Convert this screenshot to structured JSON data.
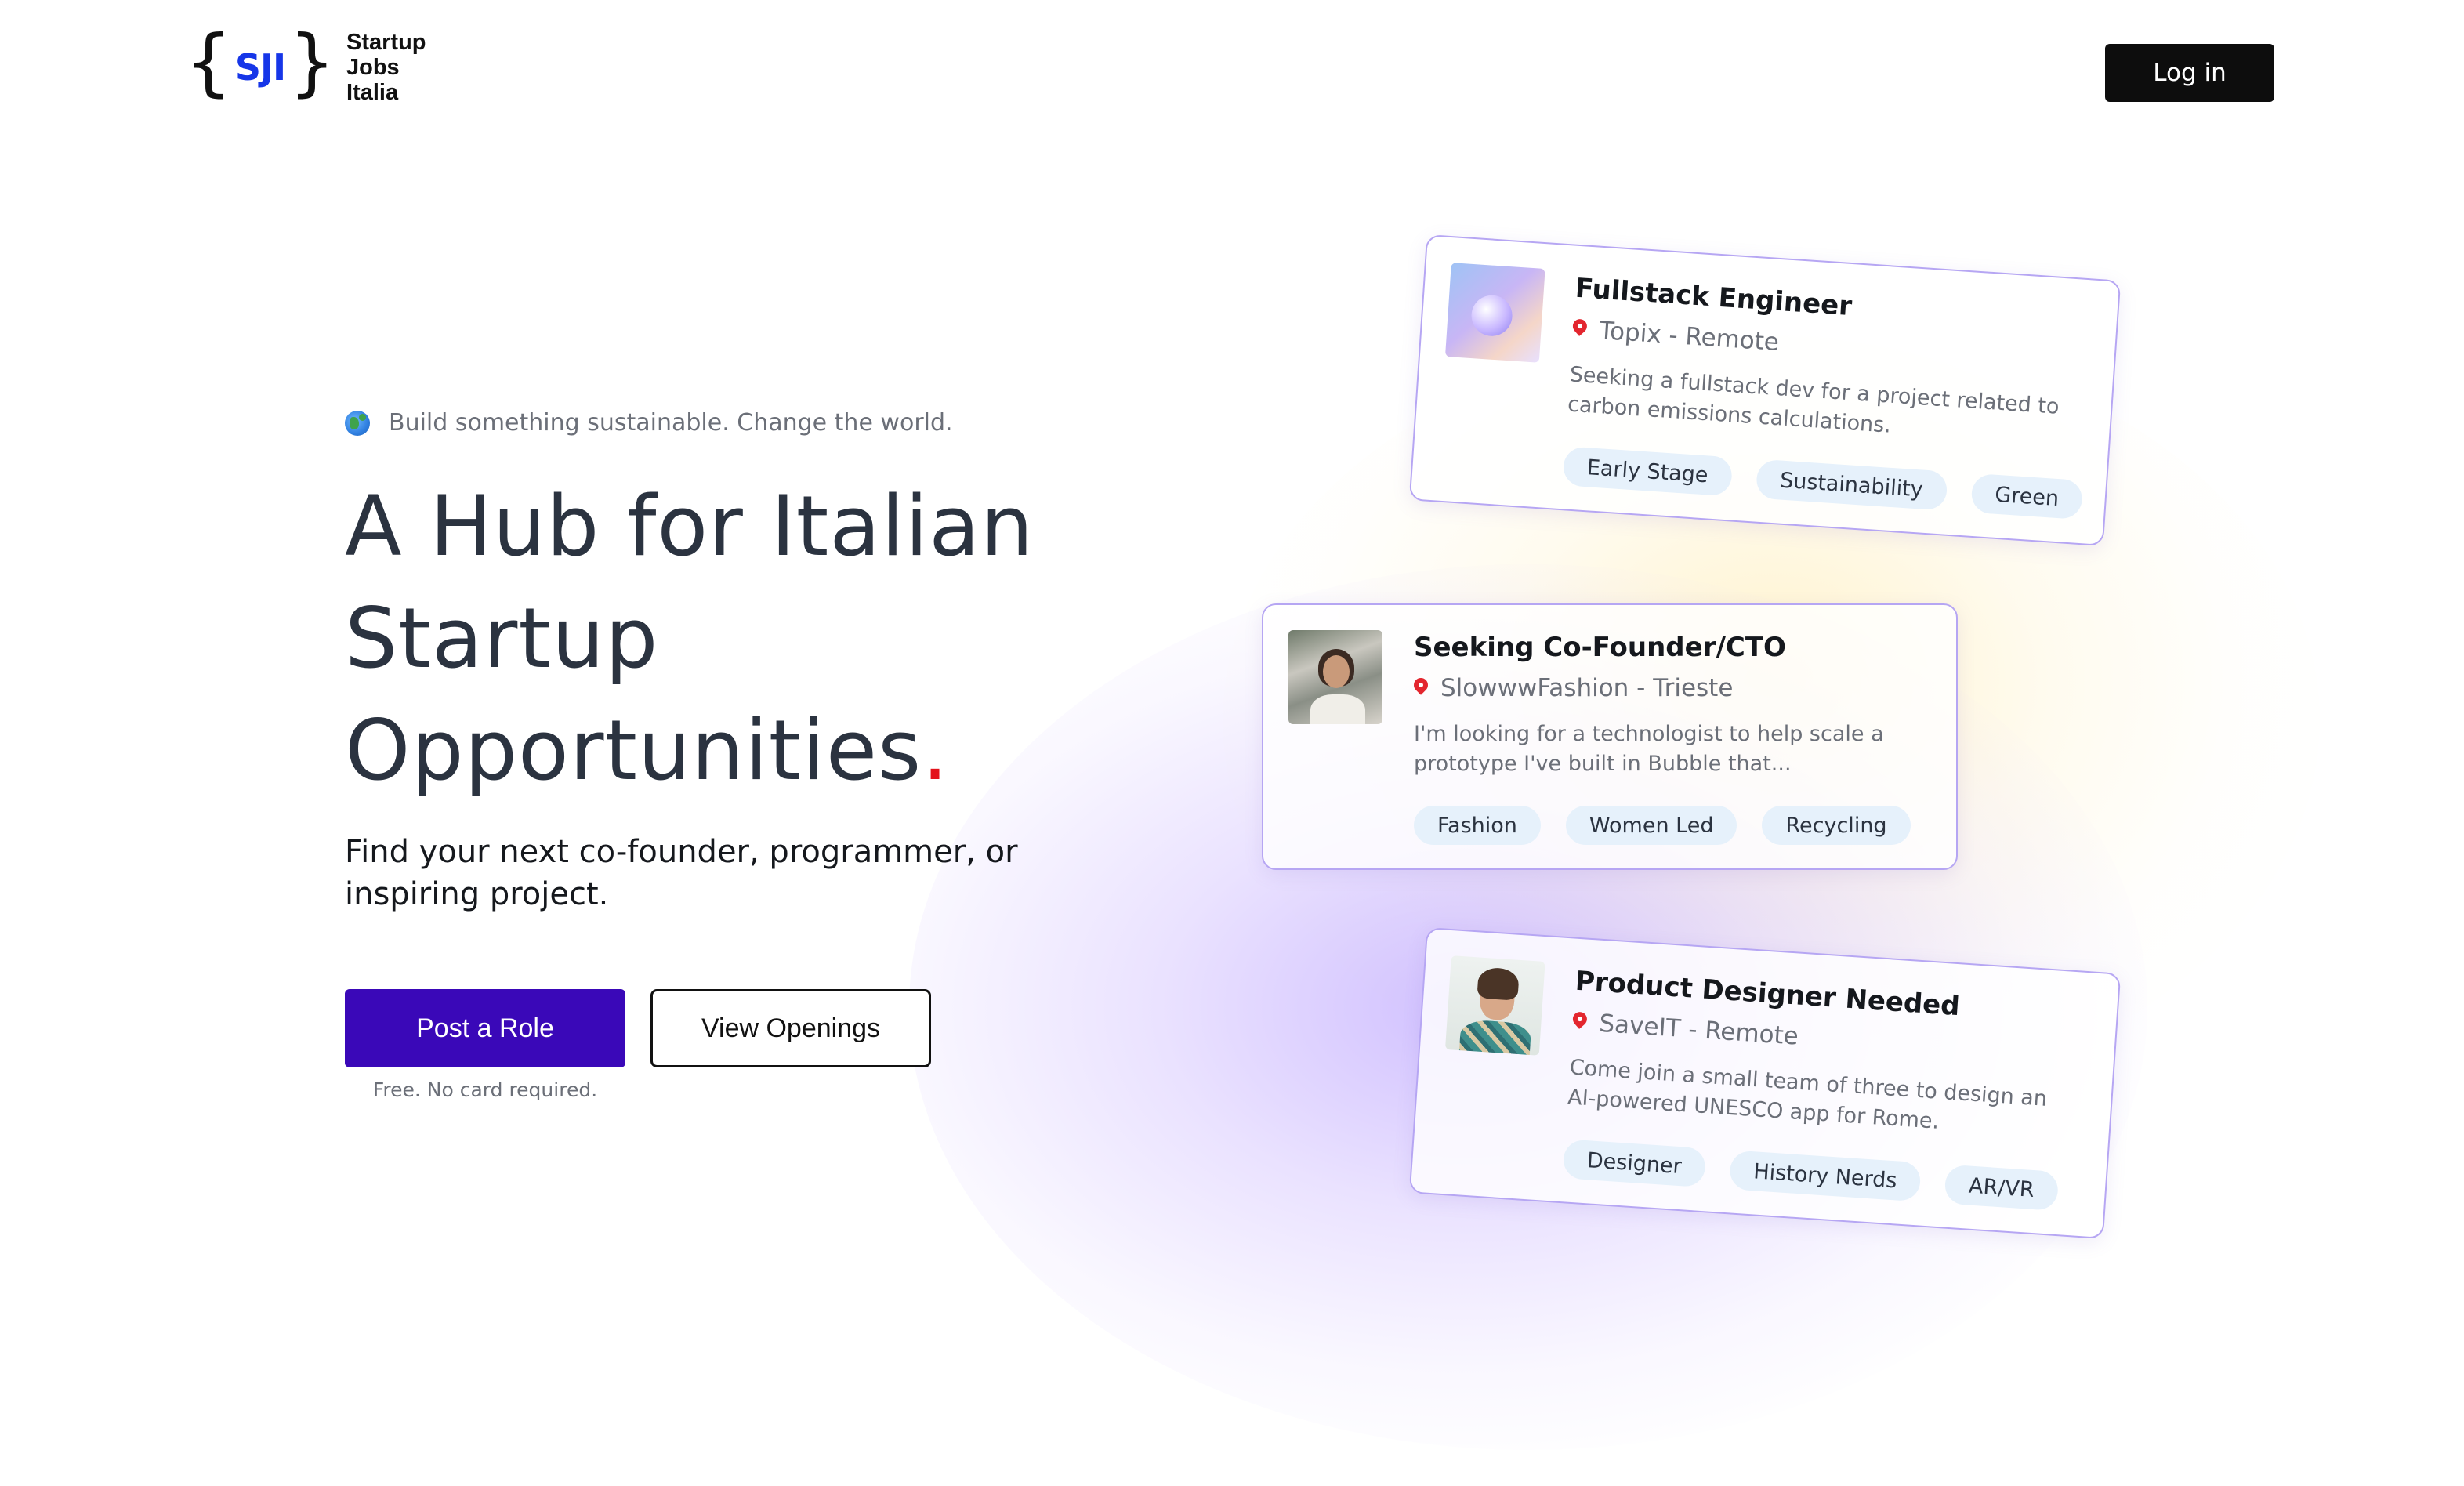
{
  "header": {
    "logo_letters": "SJI",
    "logo_brace_open": "{",
    "logo_brace_close": "}",
    "logo_line1": "Startup",
    "logo_line2": "Jobs",
    "logo_line3": "Italia",
    "login_label": "Log in"
  },
  "hero": {
    "tagline_icon": "globe-icon",
    "tagline": "Build something sustainable. Change the world.",
    "title_line1": "A Hub for Italian",
    "title_line2": "Startup",
    "title_line3": "Opportunities",
    "title_dot": ".",
    "subtitle": "Find your next co-founder, programmer, or inspiring project.",
    "post_role_label": "Post a Role",
    "view_openings_label": "View Openings",
    "free_note": "Free. No card required."
  },
  "colors": {
    "primary": "#3a08b8",
    "logo_blue": "#1636e8",
    "accent_red": "#e3121b",
    "card_border": "#b6a6f3",
    "tag_bg": "#e6f1fb"
  },
  "jobs": [
    {
      "title": "Fullstack Engineer",
      "location": "Topix - Remote",
      "description": "Seeking a fullstack dev for a project related to carbon emissions calculations.",
      "tags": [
        "Early Stage",
        "Sustainability",
        "Green"
      ]
    },
    {
      "title": "Seeking Co-Founder/CTO",
      "location": "SlowwwFashion - Trieste",
      "description": "I'm looking for a technologist to help scale a prototype I've built in Bubble that...",
      "tags": [
        "Fashion",
        "Women Led",
        "Recycling"
      ]
    },
    {
      "title": "Product Designer Needed",
      "location": "SaveIT - Remote",
      "description": "Come join a small team of three to design an AI-powered UNESCO app for Rome.",
      "tags": [
        "Designer",
        "History Nerds",
        "AR/VR"
      ]
    }
  ]
}
